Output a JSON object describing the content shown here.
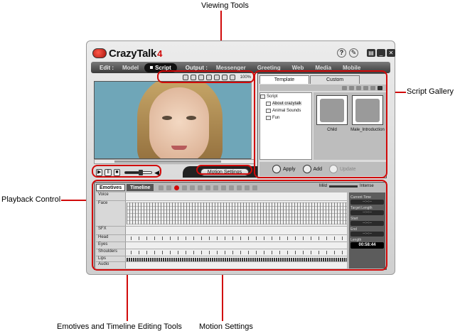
{
  "callouts": {
    "viewing_tools": "Viewing Tools",
    "script_gallery": "Script Gallery",
    "playback_control": "Playback Control",
    "emotives_tools": "Emotives and Timeline Editing Tools",
    "motion_settings": "Motion Settings"
  },
  "app": {
    "name": "CrazyTalk",
    "version": "4",
    "help": "?"
  },
  "menubar": {
    "edit_label": "Edit :",
    "output_label": "Output :",
    "items": [
      "Model",
      "Script",
      "Messenger",
      "Greeting",
      "Web",
      "Media",
      "Mobile"
    ],
    "active": "Script"
  },
  "viewer": {
    "zoom": "100%"
  },
  "playback": {
    "volume": 0.6
  },
  "motion_settings_label": "Motion Settings",
  "gallery": {
    "tabs": [
      "Template",
      "Custom"
    ],
    "active_tab": "Template",
    "tree_root": "Script",
    "tree_items": [
      "About crazytalk",
      "Animal Sounds",
      "Fun"
    ],
    "selected_item": "About crazytalk",
    "thumbnails": [
      "Child",
      "Male_Introduction"
    ],
    "actions": {
      "apply": "Apply",
      "add": "Add",
      "update": "Update"
    }
  },
  "timeline": {
    "tabs": [
      "Emotives",
      "Timeline"
    ],
    "mild": "Mild",
    "intense": "Intense",
    "tracks": [
      "Voice",
      "Face",
      "SFX",
      "Head",
      "Eyes",
      "Shoulders",
      "Lips",
      "Audio"
    ],
    "side": {
      "current_time": "Current Time",
      "target_length": "Target Length",
      "start": "Start",
      "end": "End",
      "length": "Length",
      "placeholder": "--:--:--",
      "length_value": "00:58:44"
    }
  }
}
